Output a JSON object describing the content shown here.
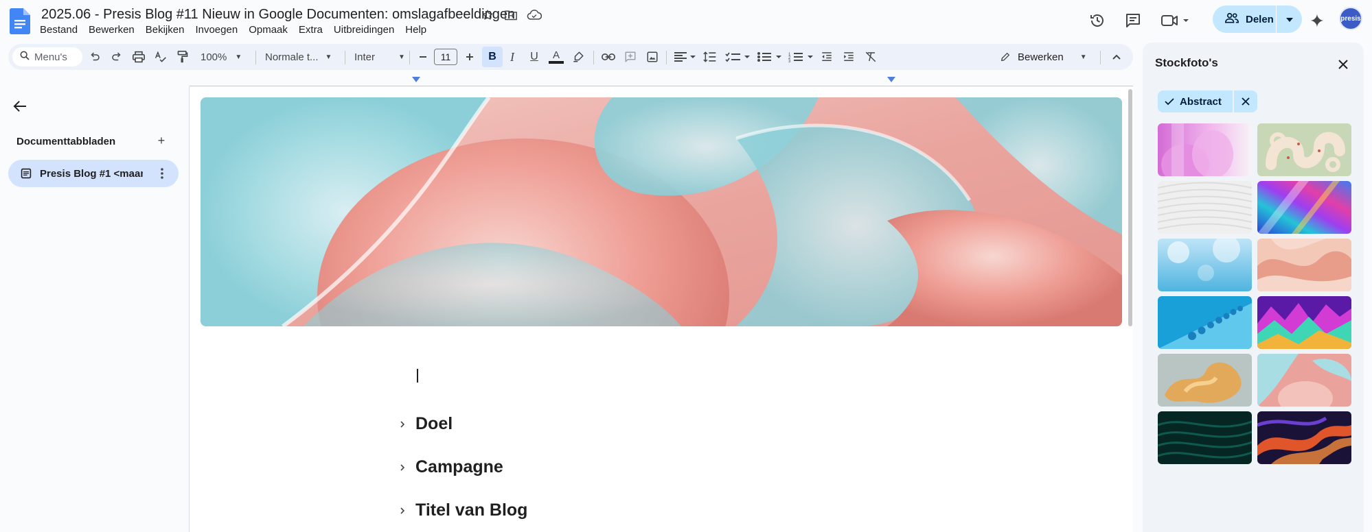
{
  "document": {
    "title": "2025.06 - Presis Blog #11 Nieuw in Google Documenten: omslagafbeeldingen"
  },
  "menu": [
    "Bestand",
    "Bewerken",
    "Bekijken",
    "Invoegen",
    "Opmaak",
    "Extra",
    "Uitbreidingen",
    "Help"
  ],
  "header": {
    "share_label": "Delen",
    "avatar_text": "presis"
  },
  "toolbar": {
    "search_placeholder": "Menu's",
    "zoom": "100%",
    "style": "Normale t...",
    "font": "Inter",
    "font_size": "11",
    "edit_mode": "Bewerken"
  },
  "left_panel": {
    "heading": "Documenttabbladen",
    "tabs": [
      {
        "label": "Presis Blog #1 <maand..."
      }
    ]
  },
  "body": {
    "headings": [
      "Doel",
      "Campagne",
      "Titel van Blog"
    ]
  },
  "right_panel": {
    "title": "Stockfoto's",
    "chip_label": "Abstract",
    "thumbnails": [
      "pink-glass-curves",
      "cream-pearl-spiral",
      "white-ribbed-waves",
      "rainbow-diagonal-streaks",
      "sky-blue-bokeh",
      "peach-silk-folds",
      "blue-spheres-stairs",
      "neon-purple-mountains",
      "golden-fluid-swirl",
      "pink-blue-ribbons",
      "dark-teal-waves",
      "orange-flame-swirl"
    ]
  },
  "colors": {
    "accent": "#0b57d0",
    "share_bg": "#c2e7ff",
    "active_tab": "#d3e3fd",
    "toolbar_bg": "#edf2fa"
  }
}
